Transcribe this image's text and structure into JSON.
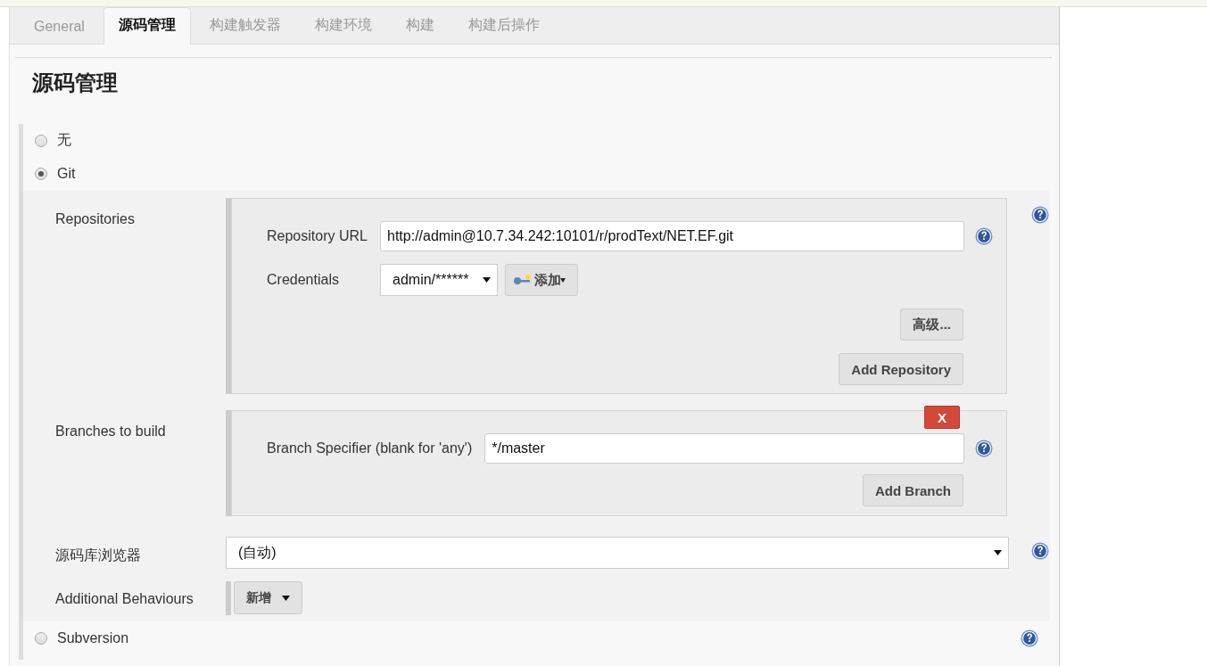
{
  "tabs": [
    {
      "label": "General",
      "selected": false
    },
    {
      "label": "源码管理",
      "selected": true
    },
    {
      "label": "构建触发器",
      "selected": false
    },
    {
      "label": "构建环境",
      "selected": false
    },
    {
      "label": "构建",
      "selected": false
    },
    {
      "label": "构建后操作",
      "selected": false
    }
  ],
  "section_title": "源码管理",
  "scm_options": [
    {
      "label": "无",
      "selected": false
    },
    {
      "label": "Git",
      "selected": true
    },
    {
      "label": "Subversion",
      "selected": false
    }
  ],
  "git": {
    "repositories": {
      "label": "Repositories",
      "url_label": "Repository URL",
      "url_value": "http://admin@10.7.34.242:10101/r/prodText/NET.EF.git",
      "credentials_label": "Credentials",
      "credentials_value": "admin/******",
      "add_credential_button": "添加",
      "advanced_button": "高级...",
      "add_button": "Add Repository"
    },
    "branches": {
      "label": "Branches to build",
      "delete_button": "X",
      "specifier_label": "Branch Specifier (blank for 'any')",
      "specifier_value": "*/master",
      "add_button": "Add Branch"
    },
    "browser": {
      "label": "源码库浏览器",
      "value": "(自动)"
    },
    "behaviours": {
      "label": "Additional Behaviours",
      "button": "新增"
    }
  }
}
